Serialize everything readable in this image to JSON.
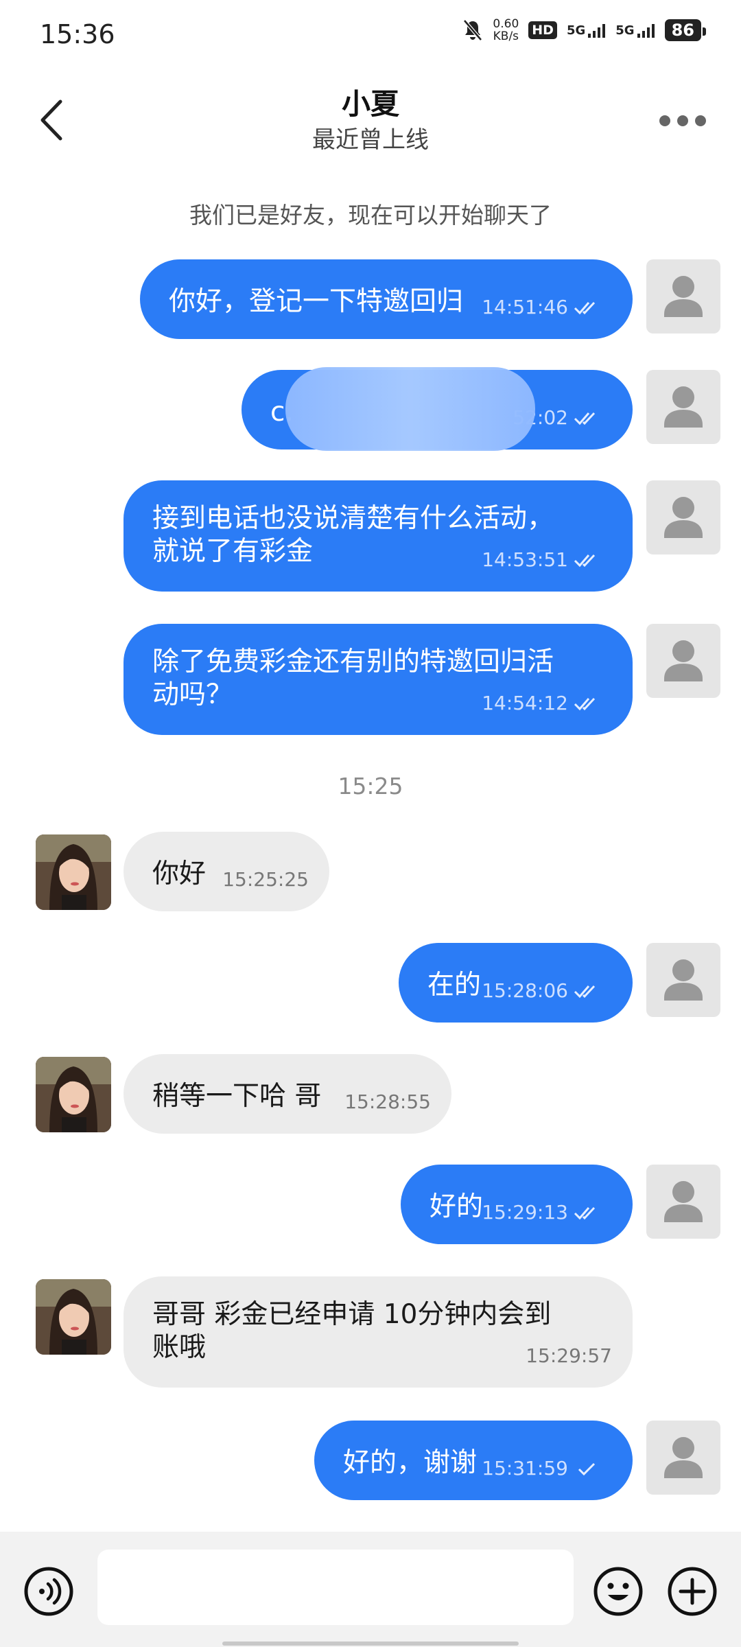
{
  "status_bar": {
    "time": "15:36",
    "net_speed": "0.60",
    "net_unit": "KB/s",
    "hd": "HD",
    "sim1": "5G",
    "sim2": "5G",
    "battery": "86"
  },
  "header": {
    "contact_name": "小夏",
    "presence": "最近曾上线",
    "back_icon": "chevron-left-icon",
    "more_icon": "more-dots-icon"
  },
  "system_message": "我们已是好友，现在可以开始聊天了",
  "time_separator": "15:25",
  "messages": [
    {
      "dir": "out",
      "text": "你好，登记一下特邀回归",
      "time": "14:51:46",
      "status": "read"
    },
    {
      "dir": "out",
      "text": "c.",
      "time": "52:02",
      "status": "read"
    },
    {
      "dir": "out",
      "text": "接到电话也没说清楚有什么活动，\n就说了有彩金",
      "time": "14:53:51",
      "status": "read"
    },
    {
      "dir": "out",
      "text": "除了免费彩金还有别的特邀回归活\n动吗？",
      "time": "14:54:12",
      "status": "read"
    },
    {
      "dir": "in",
      "text": "你好",
      "time": "15:25:25"
    },
    {
      "dir": "out",
      "text": "在的",
      "time": "15:28:06",
      "status": "read"
    },
    {
      "dir": "in",
      "text": "稍等一下哈 哥",
      "time": "15:28:55"
    },
    {
      "dir": "out",
      "text": "好的",
      "time": "15:29:13",
      "status": "read"
    },
    {
      "dir": "in",
      "text": "哥哥 彩金已经申请  10分钟内会到\n账哦",
      "time": "15:29:57"
    },
    {
      "dir": "out",
      "text": "好的，谢谢",
      "time": "15:31:59",
      "status": "sent"
    }
  ],
  "colors": {
    "outgoing_bubble": "#2b7cf6",
    "incoming_bubble": "#ececec",
    "background": "#ffffff"
  },
  "input_bar": {
    "voice_icon": "voice-icon",
    "emoji_icon": "emoji-icon",
    "plus_icon": "plus-icon"
  }
}
